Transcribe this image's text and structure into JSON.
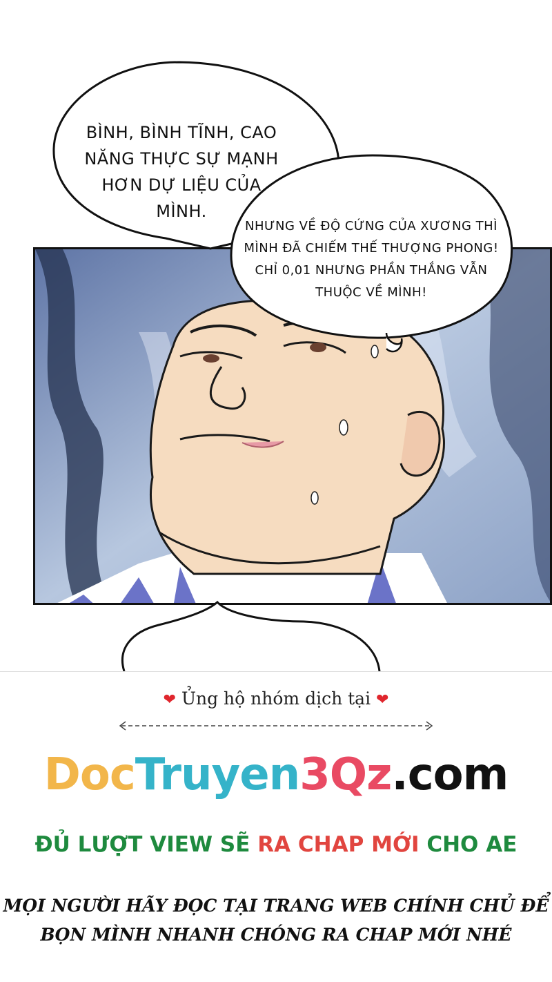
{
  "comic": {
    "bubble1": {
      "lines": [
        "BÌNH, BÌNH TĨNH, CAO",
        "NĂNG THỰC SỰ MẠNH",
        "HƠN DỰ LIỆU CỦA MÌNH."
      ]
    },
    "bubble2": {
      "lines": [
        "NHƯNG VỀ ĐỘ CỨNG CỦA XƯƠNG THÌ",
        "MÌNH ĐÃ CHIẾM THẾ THƯỢNG PHONG!",
        "CHỈ 0,01 NHƯNG PHẦN THẮNG VẪN",
        "THUỘC VỀ MÌNH!"
      ]
    }
  },
  "banner": {
    "support_text": "Ủng hộ nhóm dịch tại",
    "heart_icon": "❤",
    "site_parts": [
      "Doc",
      "Truyen",
      "3Qz",
      ".com"
    ],
    "view_green_1": "ĐỦ LƯỢT VIEW SẼ",
    "view_red": "RA CHAP MỚI",
    "view_green_2": "CHO AE",
    "notice_lines": [
      "MỌI NGƯỜI HÃY ĐỌC TẠI TRANG WEB CHÍNH CHỦ ĐỂ",
      "BỌN MÌNH NHANH CHÓNG RA CHAP MỚI NHÉ"
    ],
    "colors": {
      "doc": "#f2b64a",
      "truyen": "#35b3c9",
      "threeqz": "#e94a63",
      "com": "#111111",
      "green": "#1e8a3e",
      "red": "#e1453f",
      "heart": "#e0262d"
    }
  }
}
